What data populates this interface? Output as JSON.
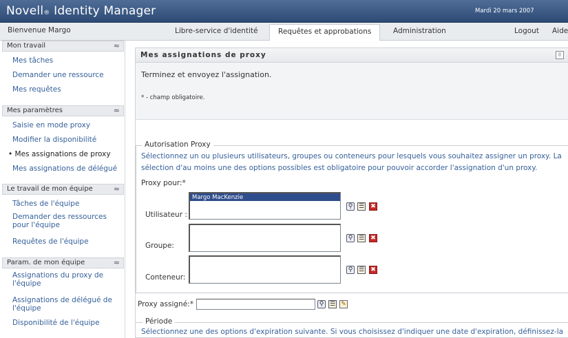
{
  "header": {
    "brand": "Novell",
    "brand_reg": "®",
    "product": " Identity Manager",
    "date": "Mardi 20 mars 2007"
  },
  "topbar": {
    "welcome": "Bienvenue Margo",
    "tabs": [
      {
        "label": "Libre-service d'identité"
      },
      {
        "label": "Requêtes et approbations"
      },
      {
        "label": "Administration"
      },
      {
        "label": "Logout"
      },
      {
        "label": "Aide"
      }
    ]
  },
  "sidebar": {
    "sections": [
      {
        "title": "Mon travail",
        "items": [
          "Mes tâches",
          "Demander une ressource",
          "Mes requêtes"
        ]
      },
      {
        "title": "Mes paramètres",
        "items": [
          "Saisie en mode proxy",
          "Modifier la disponibilité",
          "Mes assignations de proxy",
          "Mes assignations de délégué"
        ]
      },
      {
        "title": "Le travail de mon équipe",
        "items": [
          "Tâches de l'équipe",
          "Demander des ressources pour l'équipe",
          "Requêtes de l'équipe"
        ]
      },
      {
        "title": "Param. de mon équipe",
        "items": [
          "Assignations du proxy de l'équipe",
          "Assignations de délégué de l'équipe",
          "Disponibilité de l'équipe"
        ]
      }
    ],
    "current_marker": "•"
  },
  "panel": {
    "title": "Mes assignations de proxy",
    "instruction": "Terminez et envoyez l'assignation.",
    "required_note": "* - champ obligatoire.",
    "auth": {
      "legend": "Autorisation Proxy",
      "desc_line1": "Sélectionnez un ou plusieurs utilisateurs, groupes ou conteneurs pour lesquels vous souhaitez assigner un proxy. La",
      "desc_line2": "sélection d'au moins une des options possibles est obligatoire pour pouvoir accorder l'assignation d'un proxy.",
      "proxy_for": "Proxy pour:*",
      "user_label": "Utilisateur :",
      "user_selected": "Margo MacKenzie",
      "group_label": "Groupe:",
      "container_label": "Conteneur:"
    },
    "assigned_label": "Proxy assigné:*",
    "assigned_value": "",
    "period": {
      "legend": "Période",
      "desc": "Sélectionnez une des options d'expiration suivante. Si vous choisissez d'indiquer une date d'expiration, définissez-la"
    }
  }
}
